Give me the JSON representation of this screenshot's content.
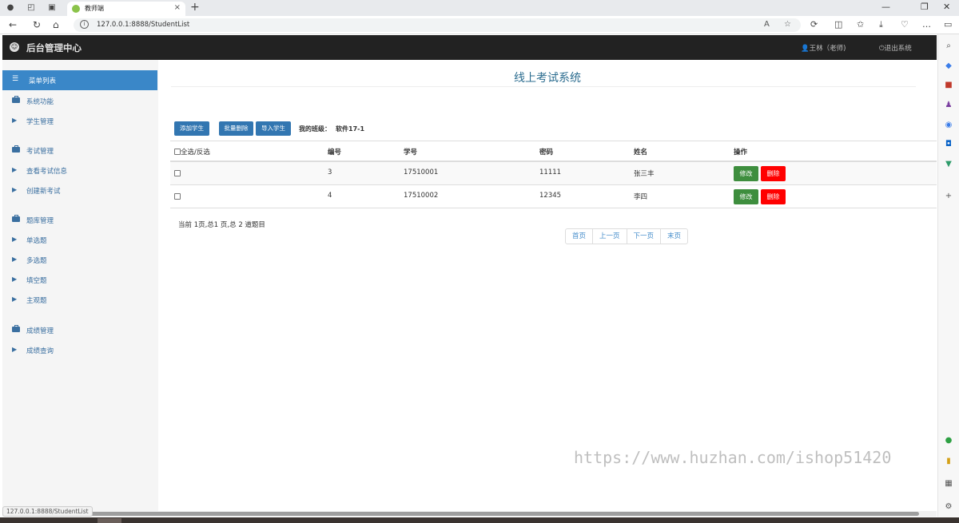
{
  "browser": {
    "tab_title": "教师端",
    "url": "127.0.0.1:8888/StudentList",
    "status_url": "127.0.0.1:8888/StudentList"
  },
  "app": {
    "title": "后台管理中心",
    "user": "王林（老师)",
    "logout": "退出系统"
  },
  "sidebar": {
    "active": "菜单列表",
    "groups": [
      {
        "label": "系统功能",
        "items": [
          "学生管理"
        ]
      },
      {
        "label": "考试管理",
        "items": [
          "查看考试信息",
          "创建新考试"
        ]
      },
      {
        "label": "题库管理",
        "items": [
          "单选题",
          "多选题",
          "填空题",
          "主观题"
        ]
      },
      {
        "label": "成绩管理",
        "items": [
          "成绩查询"
        ]
      }
    ]
  },
  "main": {
    "title": "线上考试系统",
    "buttons": {
      "add": "添加学生",
      "batch_delete": "批量删除",
      "import": "导入学生"
    },
    "class_label": "我的班级：",
    "class_value": "软件17-1",
    "table": {
      "select_all": "全选/反选",
      "headers": [
        "编号",
        "学号",
        "密码",
        "姓名",
        "操作"
      ],
      "rows": [
        {
          "id": "3",
          "student_no": "17510001",
          "password": "11111",
          "name": "张三丰"
        },
        {
          "id": "4",
          "student_no": "17510002",
          "password": "12345",
          "name": "李四"
        }
      ],
      "edit_label": "修改",
      "delete_label": "删除"
    },
    "page_info": "当前 1页,总1 页,总 2 道题目",
    "pager": [
      "首页",
      "上一页",
      "下一页",
      "末页"
    ]
  },
  "watermark": "https://www.huzhan.com/ishop51420"
}
